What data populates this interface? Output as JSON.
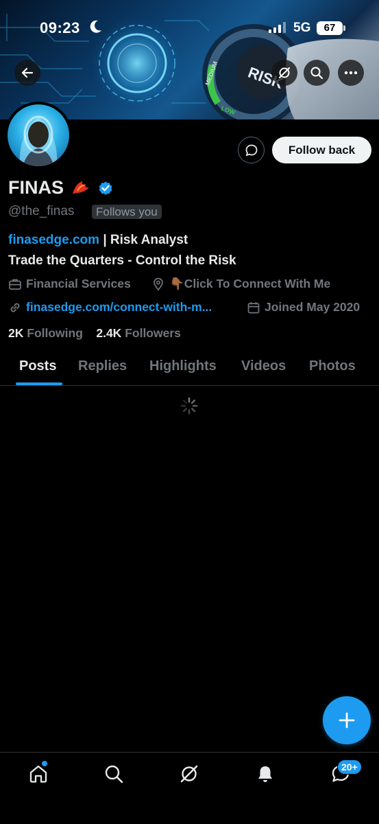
{
  "status_bar": {
    "time": "09:23",
    "network": "5G",
    "battery": "67"
  },
  "banner": {
    "risk_text": "RISK",
    "low_text": "LOW",
    "medium_text": "MEDIUM"
  },
  "profile": {
    "name": "FINAS",
    "handle": "@the_finas",
    "follows_you": "Follows you",
    "follow_button": "Follow back",
    "bio_link": "finasedge.com",
    "bio_rest": " | Risk Analyst",
    "bio_line2": "Trade the Quarters - Control the Risk",
    "category": "Financial Services",
    "location": "👇🏾Click To Connect With Me",
    "website": "finasedge.com/connect-with-m...",
    "joined": "Joined May 2020",
    "following_count": "2K",
    "following_label": "Following",
    "followers_count": "2.4K",
    "followers_label": "Followers"
  },
  "tabs": [
    "Posts",
    "Replies",
    "Highlights",
    "Videos",
    "Photos"
  ],
  "bottom_nav": {
    "messages_badge": "20+"
  },
  "colors": {
    "accent": "#1d9bf0",
    "background": "#000000",
    "muted_text": "#71767b",
    "primary_text": "#e7e9ea"
  },
  "icons": {
    "back": "arrow-left-icon",
    "grok": "grok-icon",
    "search": "search-icon",
    "more": "more-horizontal-icon",
    "message": "message-icon",
    "verified": "verified-badge-icon",
    "category": "briefcase-icon",
    "location": "location-pin-icon",
    "website": "link-icon",
    "joined": "calendar-icon",
    "compose": "plus-icon",
    "home": "home-icon",
    "explore": "search-icon",
    "notifications": "bell-icon",
    "messages": "chat-icon"
  }
}
